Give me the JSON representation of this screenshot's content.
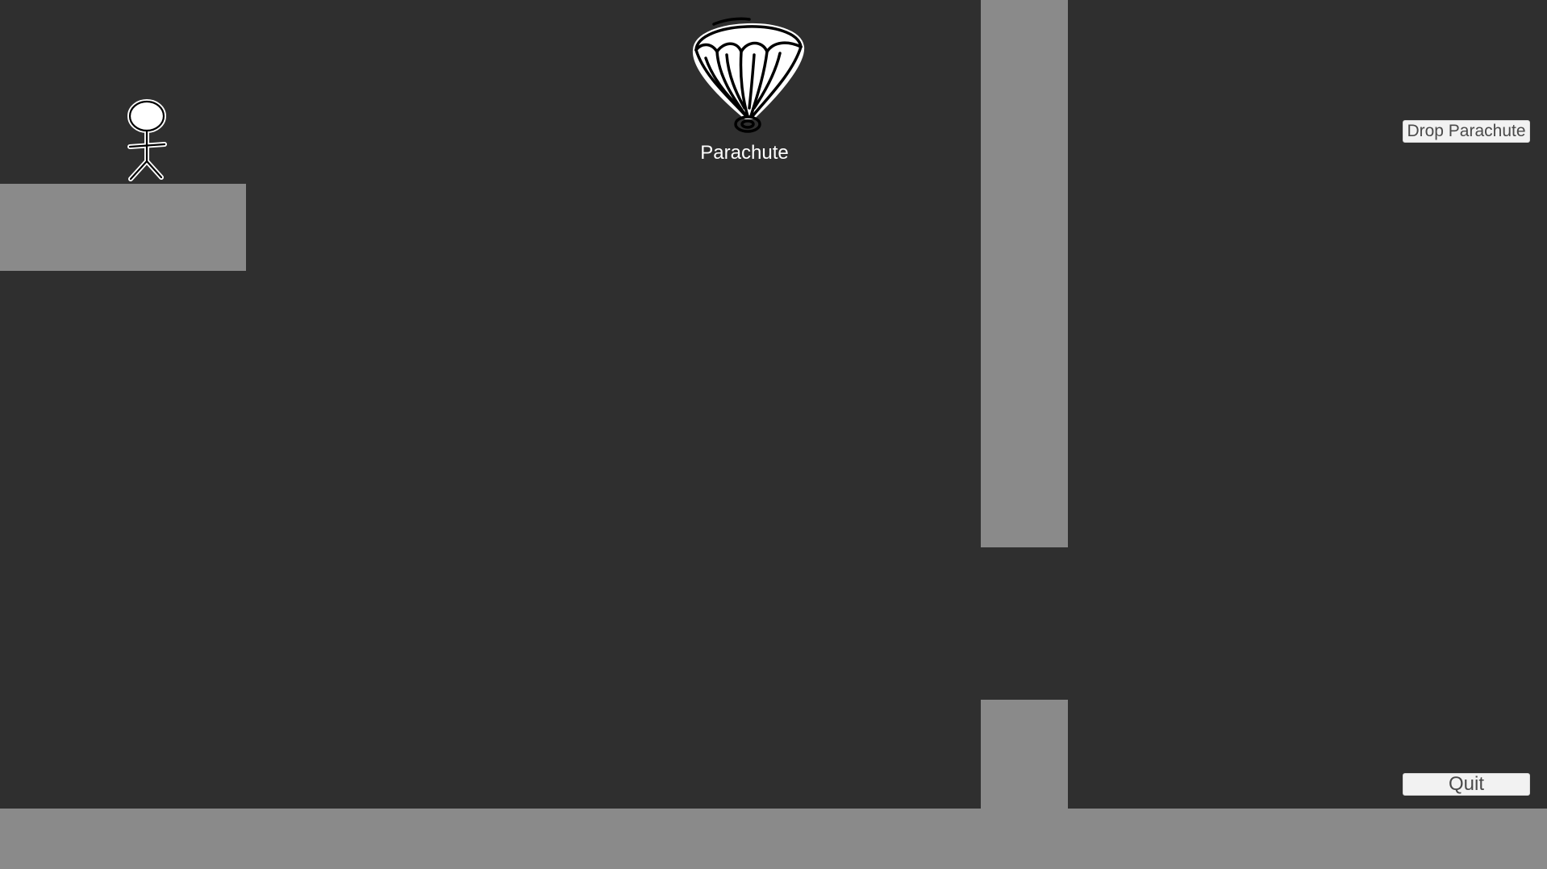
{
  "pickup": {
    "icon": "parachute-icon",
    "label": "Parachute"
  },
  "player": {
    "icon": "stickman-icon"
  },
  "controls": {
    "drop_label": "Drop Parachute",
    "quit_label": "Quit"
  },
  "colors": {
    "background": "#2f2f2f",
    "platform": "#8a8a8a",
    "button_bg": "#f2f2f2",
    "button_text": "#4a4a4a",
    "label_text": "#ffffff"
  }
}
